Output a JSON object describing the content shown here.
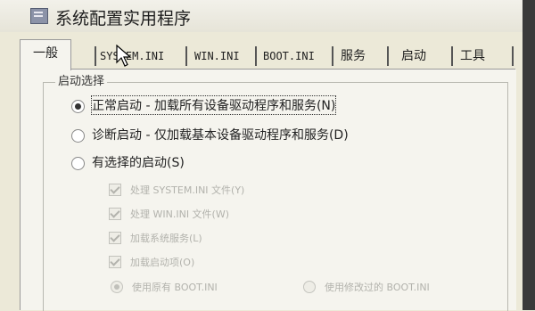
{
  "window": {
    "title": "系统配置实用程序"
  },
  "tabs": [
    {
      "label": "一般",
      "active": true
    },
    {
      "label": "SYSTEM.INI"
    },
    {
      "label": "WIN.INI"
    },
    {
      "label": "BOOT.INI"
    },
    {
      "label": "服务"
    },
    {
      "label": "启动"
    },
    {
      "label": "工具"
    }
  ],
  "startup": {
    "group_label": "启动选择",
    "options": [
      {
        "label": "正常启动 - 加载所有设备驱动程序和服务(N)",
        "selected": true
      },
      {
        "label": "诊断启动 - 仅加载基本设备驱动程序和服务(D)",
        "selected": false
      },
      {
        "label": "有选择的启动(S)",
        "selected": false
      }
    ],
    "selective_items": [
      {
        "label": "处理 SYSTEM.INI 文件(Y)",
        "checked": true,
        "enabled": false
      },
      {
        "label": "处理 WIN.INI 文件(W)",
        "checked": true,
        "enabled": false
      },
      {
        "label": "加载系统服务(L)",
        "checked": true,
        "enabled": false
      },
      {
        "label": "加载启动项(O)",
        "checked": true,
        "enabled": false
      }
    ],
    "boot_ini": [
      {
        "label": "使用原有 BOOT.INI",
        "selected": true,
        "enabled": false
      },
      {
        "label": "使用修改过的 BOOT.INI",
        "selected": false,
        "enabled": false
      }
    ]
  }
}
